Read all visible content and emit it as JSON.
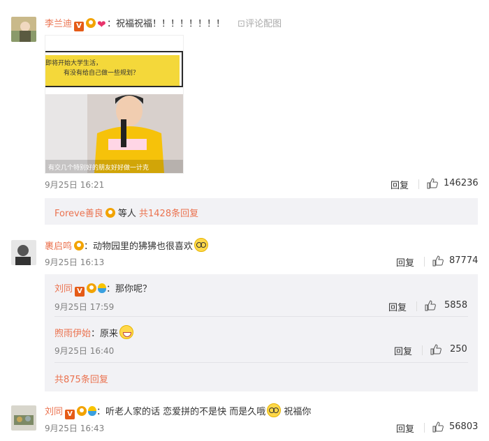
{
  "comments": [
    {
      "username": "李兰迪",
      "text": "：祝福祝福！！！！！！！！",
      "pic_link": "评论配图",
      "time": "9月25日 16:21",
      "reply_label": "回复",
      "likes": "146236",
      "image_caption": {
        "top_line1": "即将开始大学生活，",
        "top_line2": "有没有给自己做一些规划？",
        "subtitle": "有交几个特别好的朋友好好做一计克"
      },
      "reply_summary": {
        "name": "Foreve善良",
        "middle": "等人",
        "count_text": "共1428条回复"
      }
    },
    {
      "username": "裹启鸣",
      "text": "：动物园里的狒狒也很喜欢",
      "time": "9月25日 16:13",
      "reply_label": "回复",
      "likes": "87774",
      "replies": [
        {
          "username": "刘同",
          "text": "：那你呢？",
          "time": "9月25日 17:59",
          "reply_label": "回复",
          "likes": "5858"
        },
        {
          "username": "煦雨伊始",
          "text": "：原来",
          "time": "9月25日 16:40",
          "reply_label": "回复",
          "likes": "250"
        }
      ],
      "more_replies": "共875条回复"
    },
    {
      "username": "刘同",
      "text": "：听老人家的话 恋爱拼的不是快 而是久哦",
      "text_end": "祝福你",
      "time": "9月25日 16:43",
      "reply_label": "回复",
      "likes": "56803"
    }
  ],
  "colors": {
    "username": "#eb7350",
    "time": "#808080",
    "reply_bg": "#f2f2f5"
  },
  "icons": [
    "vip-v-icon",
    "fan-badge-icon",
    "heart-icon",
    "balloon-icon",
    "glasses-emoji-icon",
    "laugh-emoji-icon",
    "thumbs-up-icon",
    "picture-icon"
  ]
}
